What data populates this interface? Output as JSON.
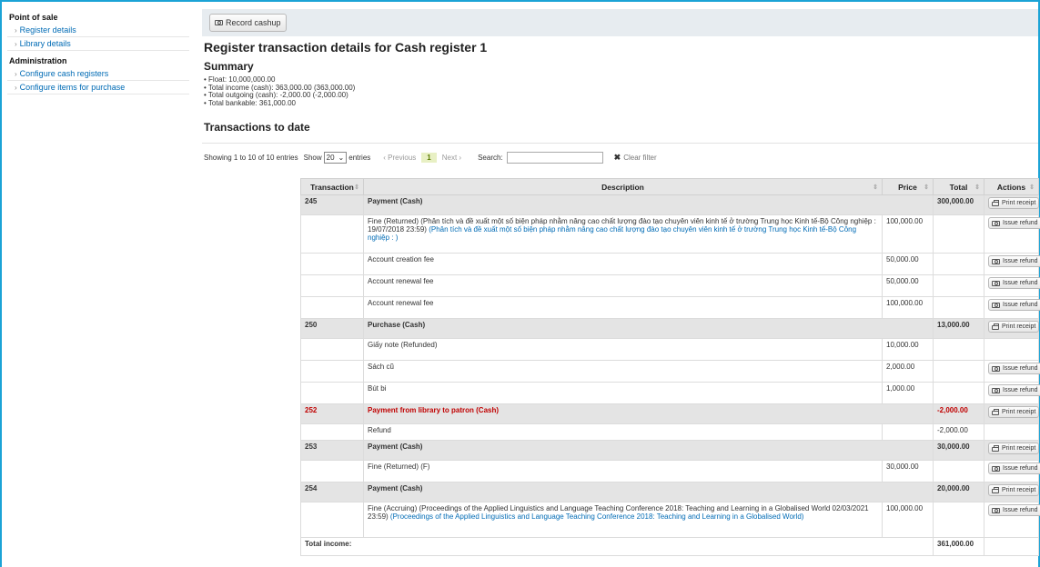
{
  "sidebar": {
    "point_of_sale_heading": "Point of sale",
    "pos_items": [
      {
        "label": "Register details"
      },
      {
        "label": "Library details"
      }
    ],
    "administration_heading": "Administration",
    "admin_items": [
      {
        "label": "Configure cash registers"
      },
      {
        "label": "Configure items for purchase"
      }
    ]
  },
  "toolbar": {
    "record_cashup_label": "Record cashup"
  },
  "page": {
    "title": "Register transaction details for Cash register 1",
    "summary_heading": "Summary",
    "summary": [
      "Float: 10,000,000.00",
      "Total income (cash): 363,000.00 (363,000.00)",
      "Total outgoing (cash): -2,000.00 (-2,000.00)",
      "Total bankable: 361,000.00"
    ],
    "transactions_heading": "Transactions to date"
  },
  "datatable": {
    "info": "Showing 1 to 10 of 10 entries",
    "show_label": "Show",
    "page_size": "20",
    "entries_label": "entries",
    "previous": "‹ Previous",
    "current_page": "1",
    "next": "Next ›",
    "search_label": "Search:",
    "search_value": "",
    "clear_filter": "Clear filter"
  },
  "table": {
    "headers": {
      "transaction": "Transaction",
      "description": "Description",
      "price": "Price",
      "total": "Total",
      "actions": "Actions"
    },
    "print_receipt": "Print receipt",
    "issue_refund": "Issue refund",
    "txn245": {
      "id": "245",
      "desc": "Payment (Cash)",
      "total": "300,000.00"
    },
    "txn245_items": [
      {
        "desc": "Fine (Returned) (Phân tích và đề xuất một số biện pháp nhằm nâng cao chất lượng đào tạo chuyên viên kinh tế ở trường Trung học Kinh tế-Bộ Công nghiệp : 19/07/2018 23:59)",
        "link": "(Phân tích và đề xuất một số biện pháp nhằm nâng cao chất lượng đào tạo chuyên viên kinh tế ở trường Trung học Kinh tế-Bộ Công nghiệp : )",
        "price": "100,000.00"
      },
      {
        "desc": "Account creation fee",
        "price": "50,000.00"
      },
      {
        "desc": "Account renewal fee",
        "price": "50,000.00"
      },
      {
        "desc": "Account renewal fee",
        "price": "100,000.00"
      }
    ],
    "txn250": {
      "id": "250",
      "desc": "Purchase (Cash)",
      "total": "13,000.00"
    },
    "txn250_items": [
      {
        "desc": "Giấy note (Refunded)",
        "price": "10,000.00"
      },
      {
        "desc": "Sách cũ",
        "price": "2,000.00"
      },
      {
        "desc": "Bút bi",
        "price": "1,000.00"
      }
    ],
    "txn252": {
      "id": "252",
      "desc": "Payment from library to patron (Cash)",
      "total": "-2,000.00"
    },
    "txn252_items": [
      {
        "desc": "Refund",
        "total": "-2,000.00"
      }
    ],
    "txn253": {
      "id": "253",
      "desc": "Payment (Cash)",
      "total": "30,000.00"
    },
    "txn253_items": [
      {
        "desc": "Fine (Returned) (F)",
        "price": "30,000.00"
      }
    ],
    "txn254": {
      "id": "254",
      "desc": "Payment (Cash)",
      "total": "20,000.00"
    },
    "txn254_items": [
      {
        "desc": "Fine (Accruing) (Proceedings of the Applied Linguistics and Language Teaching Conference 2018: Teaching and Learning in a Globalised World 02/03/2021 23:59)",
        "link": "(Proceedings of the Applied Linguistics and Language Teaching Conference 2018: Teaching and Learning in a Globalised World)",
        "price": "100,000.00"
      }
    ],
    "footer": {
      "label": "Total income:",
      "total": "361,000.00"
    }
  },
  "colors": {
    "frame_border": "#1ba3d6",
    "link": "#006bb5",
    "positive": "#5a9b00",
    "negative": "#c00000"
  }
}
